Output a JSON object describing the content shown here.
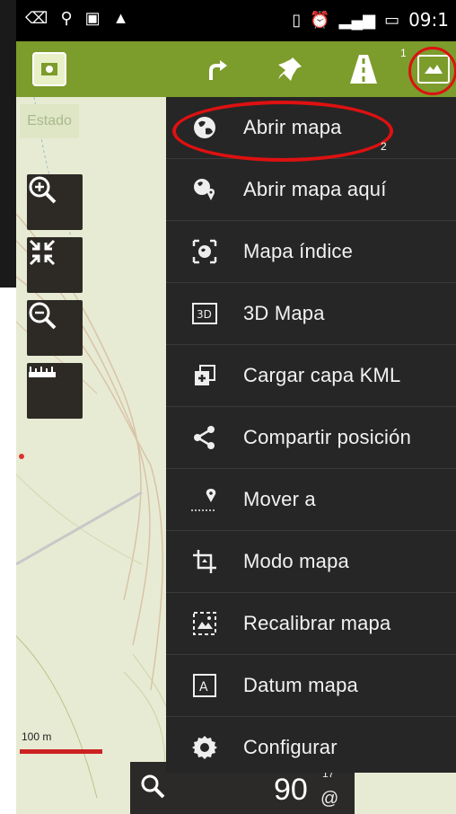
{
  "status": {
    "time": "09:1"
  },
  "toolbar": {
    "badge": "1"
  },
  "map": {
    "estado": "Estado",
    "scale": "100 m"
  },
  "menu": {
    "badge": "2",
    "items": [
      {
        "label": "Abrir mapa",
        "icon": "globe-icon"
      },
      {
        "label": "Abrir mapa aquí",
        "icon": "globe-pin-icon"
      },
      {
        "label": "Mapa índice",
        "icon": "index-map-icon"
      },
      {
        "label": "3D Mapa",
        "icon": "3d-map-icon"
      },
      {
        "label": "Cargar capa KML",
        "icon": "kml-layer-icon"
      },
      {
        "label": "Compartir posición",
        "icon": "share-icon"
      },
      {
        "label": "Mover a",
        "icon": "move-to-pin-icon"
      },
      {
        "label": "Modo mapa",
        "icon": "crop-icon"
      },
      {
        "label": "Recalibrar mapa",
        "icon": "recalibrate-icon"
      },
      {
        "label": "Datum mapa",
        "icon": "datum-icon"
      },
      {
        "label": "Configurar",
        "icon": "gear-icon"
      }
    ]
  },
  "bottom": {
    "value": "90",
    "sup": "17",
    "unit": "@"
  }
}
